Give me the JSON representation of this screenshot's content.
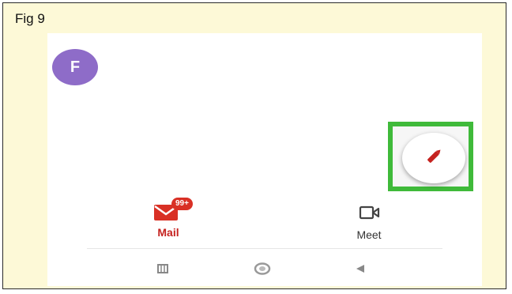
{
  "figure": {
    "label": "Fig 9"
  },
  "account": {
    "avatar_letter": "F",
    "avatar_color": "#8e6cc8"
  },
  "fab": {
    "icon": "pencil-icon",
    "highlight_color": "#3fba3a"
  },
  "bottom_nav": {
    "tabs": [
      {
        "label": "Mail",
        "icon": "mail-icon",
        "badge": "99+",
        "active": true,
        "color": "#d93025"
      },
      {
        "label": "Meet",
        "icon": "video-camera-icon",
        "active": false
      }
    ]
  },
  "system_nav": [
    "recents-icon",
    "home-icon",
    "back-icon"
  ]
}
